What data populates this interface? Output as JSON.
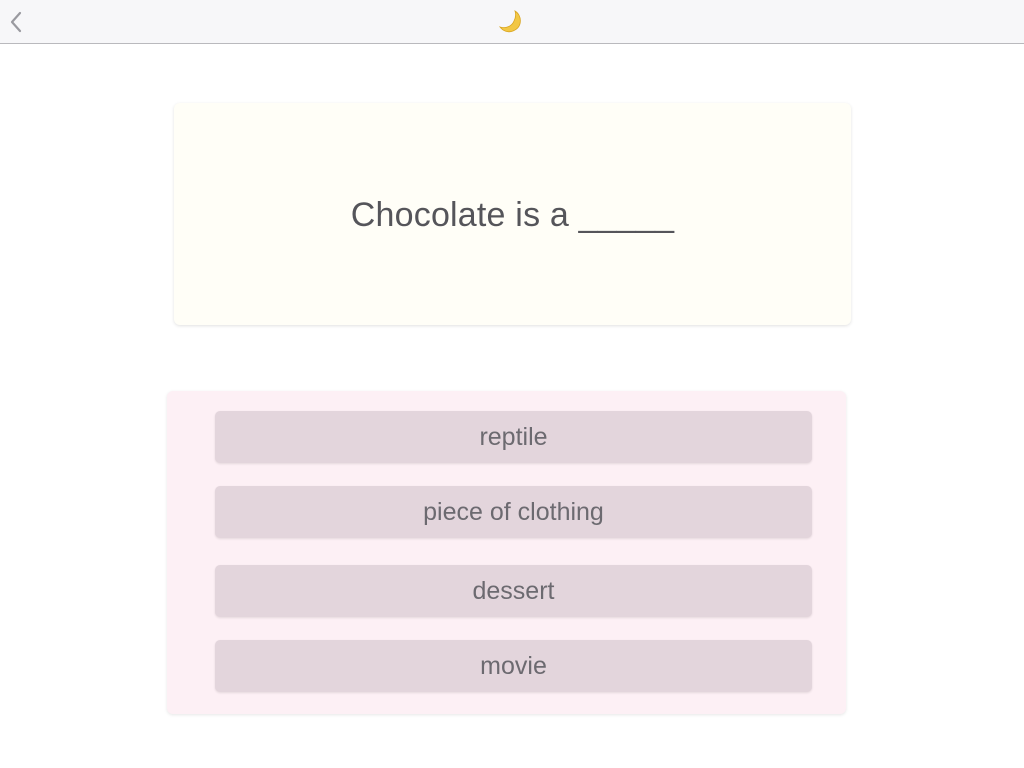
{
  "header": {
    "back_icon": "chevron-left-icon",
    "mode_icon": "crescent-moon-icon",
    "moon_color": "#f2c744"
  },
  "question": {
    "text": "Chocolate is a _____"
  },
  "answers": [
    {
      "label": "reptile"
    },
    {
      "label": "piece of clothing"
    },
    {
      "label": "dessert"
    },
    {
      "label": "movie"
    }
  ],
  "colors": {
    "question_card_bg": "#fffef7",
    "answers_panel_bg": "#fdf0f5",
    "answer_button_bg": "#e3d5dc",
    "text": "#55555a"
  }
}
